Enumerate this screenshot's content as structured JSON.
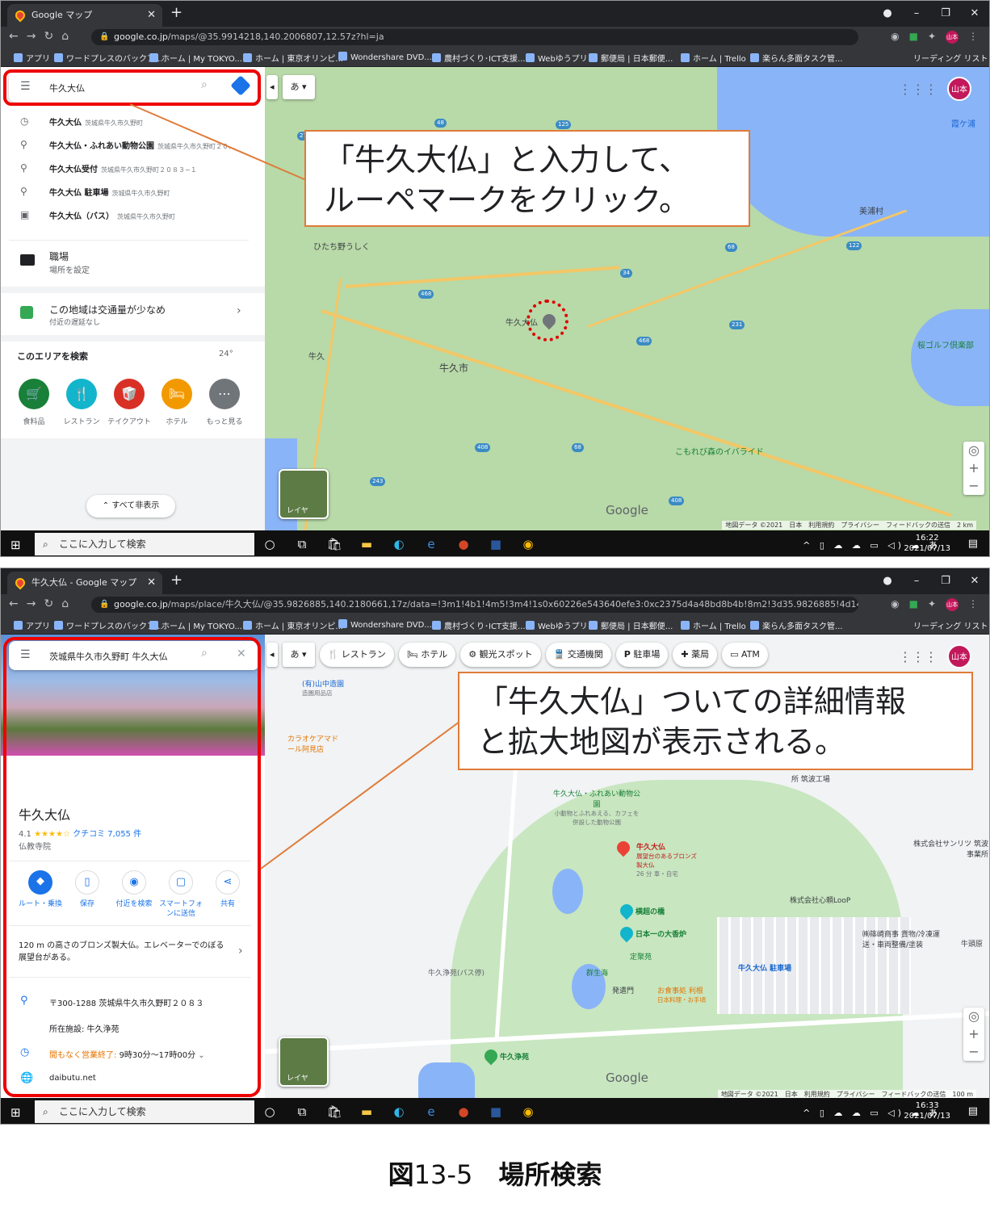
{
  "screenshot1": {
    "tab_title": "Google マップ",
    "url_host": "google.co.jp",
    "url_path": "/maps/@35.9914218,140.2006807,12.57z?hl=ja",
    "bookmarks": [
      "アプリ",
      "ワードプレスのバックア...",
      "ホーム | My TOKYO...",
      "ホーム | 東京オリンピ...",
      "Wondershare DVD...",
      "農村づくり･ICT支援...",
      "Webゆうプリ",
      "郵便局 | 日本郵便...",
      "ホーム | Trello",
      "楽らん多面タスク管..."
    ],
    "reading_list": "リーディング リスト",
    "search_value": "牛久大仏",
    "suggestions": [
      {
        "icon": "clock-icon",
        "title": "牛久大仏",
        "sub": "茨城県牛久市久野町"
      },
      {
        "icon": "pin-icon",
        "title": "牛久大仏・ふれあい動物公園",
        "sub": "茨城県牛久市久野町２０..."
      },
      {
        "icon": "pin-icon",
        "title": "牛久大仏受付",
        "sub": "茨城県牛久市久野町２０８３−１"
      },
      {
        "icon": "pin-icon",
        "title": "牛久大仏 駐車場",
        "sub": "茨城県牛久市久野町"
      },
      {
        "icon": "bus-icon",
        "title": "牛久大仏（バス）",
        "sub": "茨城県牛久市久野町"
      }
    ],
    "work_title": "職場",
    "work_sub": "場所を設定",
    "traffic_title": "この地域は交通量が少なめ",
    "traffic_sub": "付近の遅延なし",
    "area_title": "このエリアを検索",
    "weather": "24°",
    "categories": [
      "食料品",
      "レストラン",
      "テイクアウト",
      "ホテル",
      "もっと見る"
    ],
    "hide_all": "すべて非表示",
    "ime": "あ",
    "callout_line1": "「牛久大仏」と入力して、",
    "callout_line2": "ルーペマークをクリック。",
    "map_labels": [
      "霞ケ浦",
      "美浦村",
      "ひたち野うしく",
      "牛久大仏",
      "牛久",
      "牛久市",
      "こもれび森のイバライド",
      "桜ゴルフ倶楽部"
    ],
    "layers_label": "レイヤ",
    "google": "Google",
    "footer": "地図データ ©2021　日本　利用規約　プライバシー　フィードバックの送信　2 km",
    "taskbar_search": "ここに入力して検索",
    "time": "16:22",
    "date": "2021/07/13",
    "avatar": "山本"
  },
  "screenshot2": {
    "tab_title": "牛久大仏 - Google マップ",
    "url_host": "google.co.jp",
    "url_path": "/maps/place/牛久大仏/@35.9826885,140.2180661,17z/data=!3m1!4b1!4m5!3m4!1s0x60226e543640efe3:0xc2375d4a48bd8b4b!8m2!3d35.9826885!4d140.22...",
    "search_value": "茨城県牛久市久野町 牛久大仏",
    "place_name": "牛久大仏",
    "rating": "4.1",
    "stars": "★★★★☆",
    "reviews": "クチコミ 7,055 件",
    "place_type": "仏教寺院",
    "actions": [
      "ルート・乗換",
      "保存",
      "付近を検索",
      "スマートフォンに送信",
      "共有"
    ],
    "description": "120 m の高さのブロンズ製大仏。エレベーターでのぼる展望台がある。",
    "address": "〒300-1288 茨城県牛久市久野町２０８３",
    "located_in": "所在施設: 牛久浄苑",
    "hours_status": "間もなく営業終了:",
    "hours": "9時30分～17時00分",
    "website": "daibutu.net",
    "map_chips": [
      "レストラン",
      "ホテル",
      "観光スポット",
      "交通機関",
      "駐車場",
      "薬局",
      "ATM"
    ],
    "callout_line1": "「牛久大仏」ついての詳細情報",
    "callout_line2": "と拡大地図が表示される。",
    "map_labels": {
      "yamanaka": "(有)山中造園",
      "yamanaka_sub": "造園用品店",
      "karaoke": "カラオケアマドール阿見店",
      "park": "牛久大仏・ふれあい動物公園",
      "park_sub": "小動物とふれあえる、カフェを併設した動物公園",
      "buddha": "牛久大仏",
      "buddha_sub": "展望台のあるブロンズ製大仏",
      "buddha_dist": "26 分 車・自宅",
      "yokocho": "横超の橋",
      "koro": "日本一の大香炉",
      "jokaden": "定聚苑",
      "gunshokai": "群生海",
      "hatsuganmon": "発遣門",
      "shokujidokoro": "お食事処 利根",
      "shokujidokoro_sub": "日本料理・お手頃",
      "parking": "牛久大仏 駐車場",
      "bus": "牛久浄苑(バス停)",
      "joen": "牛久浄苑",
      "sanritsu": "株式会社サンリツ 筑波事業所",
      "loop": "株式会社心頼LooP",
      "shinohara": "㈱篠崎商事 貨物/冷凍運送・車両整備/塗装",
      "ushiku_kobo": "所 筑波工場",
      "ushikuhara": "牛頭原"
    },
    "layers_label": "レイヤ",
    "google": "Google",
    "footer": "地図データ ©2021　日本　利用規約　プライバシー　フィードバックの送信　100 m",
    "taskbar_search": "ここに入力して検索",
    "time": "16:33",
    "date": "2021/07/13",
    "avatar": "山本"
  },
  "caption": {
    "fig": "図",
    "num": "13-5",
    "title": "場所検索"
  },
  "colors": {
    "red_box": "#ee0000",
    "callout_border": "#e07b39",
    "accent": "#1a73e8",
    "map_green": "#b8d9a8",
    "water": "#8ab4f8",
    "road": "#f3c766"
  }
}
